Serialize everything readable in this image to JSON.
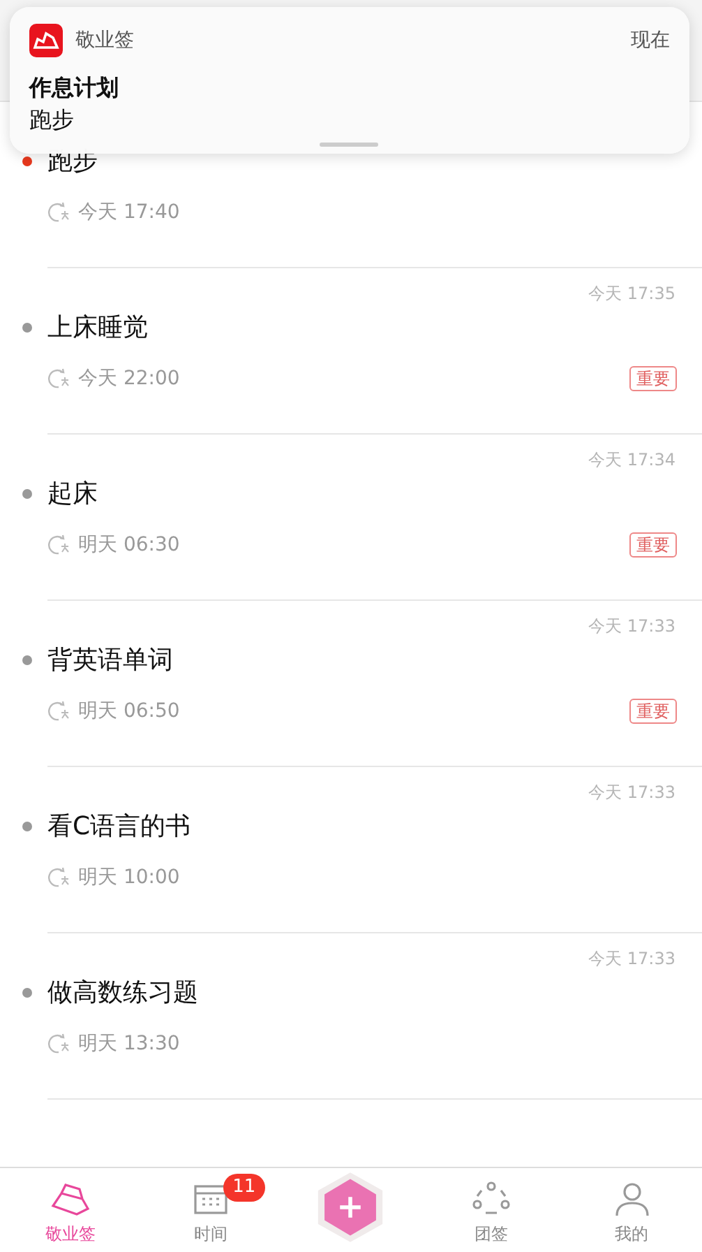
{
  "notification": {
    "app": "敬业签",
    "time": "现在",
    "title": "作息计划",
    "body": "跑步"
  },
  "items": [
    {
      "title": "跑步",
      "reminder": "今天 17:40",
      "important": false,
      "color": "#e8391e"
    },
    {
      "stamp": "今天 17:35",
      "title": "上床睡觉",
      "reminder": "今天 22:00",
      "important": true,
      "tag": "重要",
      "color": "#999999"
    },
    {
      "stamp": "今天 17:34",
      "title": "起床",
      "reminder": "明天 06:30",
      "important": true,
      "tag": "重要",
      "color": "#999999"
    },
    {
      "stamp": "今天 17:33",
      "title": "背英语单词",
      "reminder": "明天 06:50",
      "important": true,
      "tag": "重要",
      "color": "#999999"
    },
    {
      "stamp": "今天 17:33",
      "title": "看C语言的书",
      "reminder": "明天 10:00",
      "important": false,
      "color": "#999999"
    },
    {
      "stamp": "今天 17:33",
      "title": "做高数练习题",
      "reminder": "明天 13:30",
      "important": false,
      "color": "#999999"
    }
  ],
  "tabs": [
    {
      "kind": "notes",
      "label": "敬业签",
      "selected": true
    },
    {
      "kind": "calendar",
      "label": "时间",
      "selected": false,
      "badge": "11"
    },
    {
      "kind": "add"
    },
    {
      "kind": "team",
      "label": "团签",
      "selected": false
    },
    {
      "kind": "profile",
      "label": "我的",
      "selected": false
    }
  ]
}
